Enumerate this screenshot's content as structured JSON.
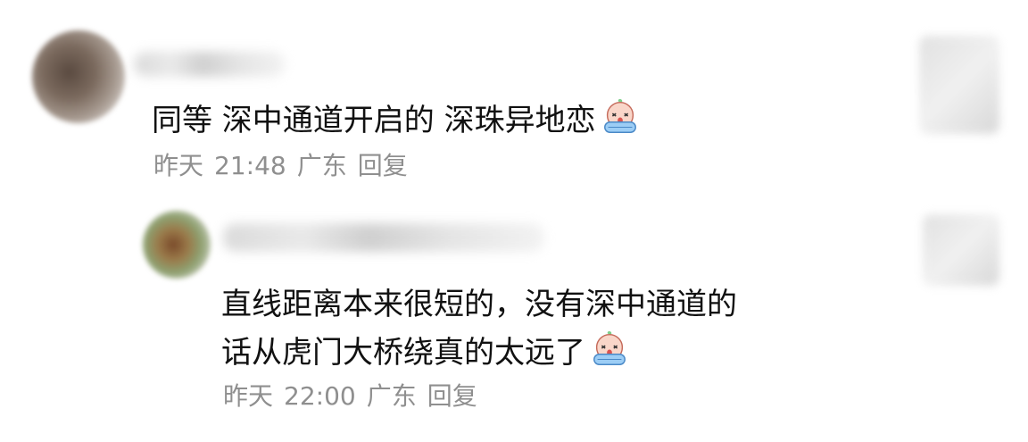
{
  "comments": [
    {
      "text": "同等 深中通道开启的 深珠异地恋",
      "emoji": "crying-face-emoji",
      "date": "昨天",
      "time": "21:48",
      "location": "广东",
      "reply_label": "回复"
    },
    {
      "text_line1": "直线距离本来很短的，没有深中通道的",
      "text_line2": "话从虎门大桥绕真的太远了",
      "emoji": "crying-face-emoji",
      "date": "昨天",
      "time": "22:00",
      "location": "广东",
      "reply_label": "回复"
    }
  ],
  "colors": {
    "text": "#111111",
    "meta": "#8f8f8f",
    "background": "#ffffff"
  }
}
